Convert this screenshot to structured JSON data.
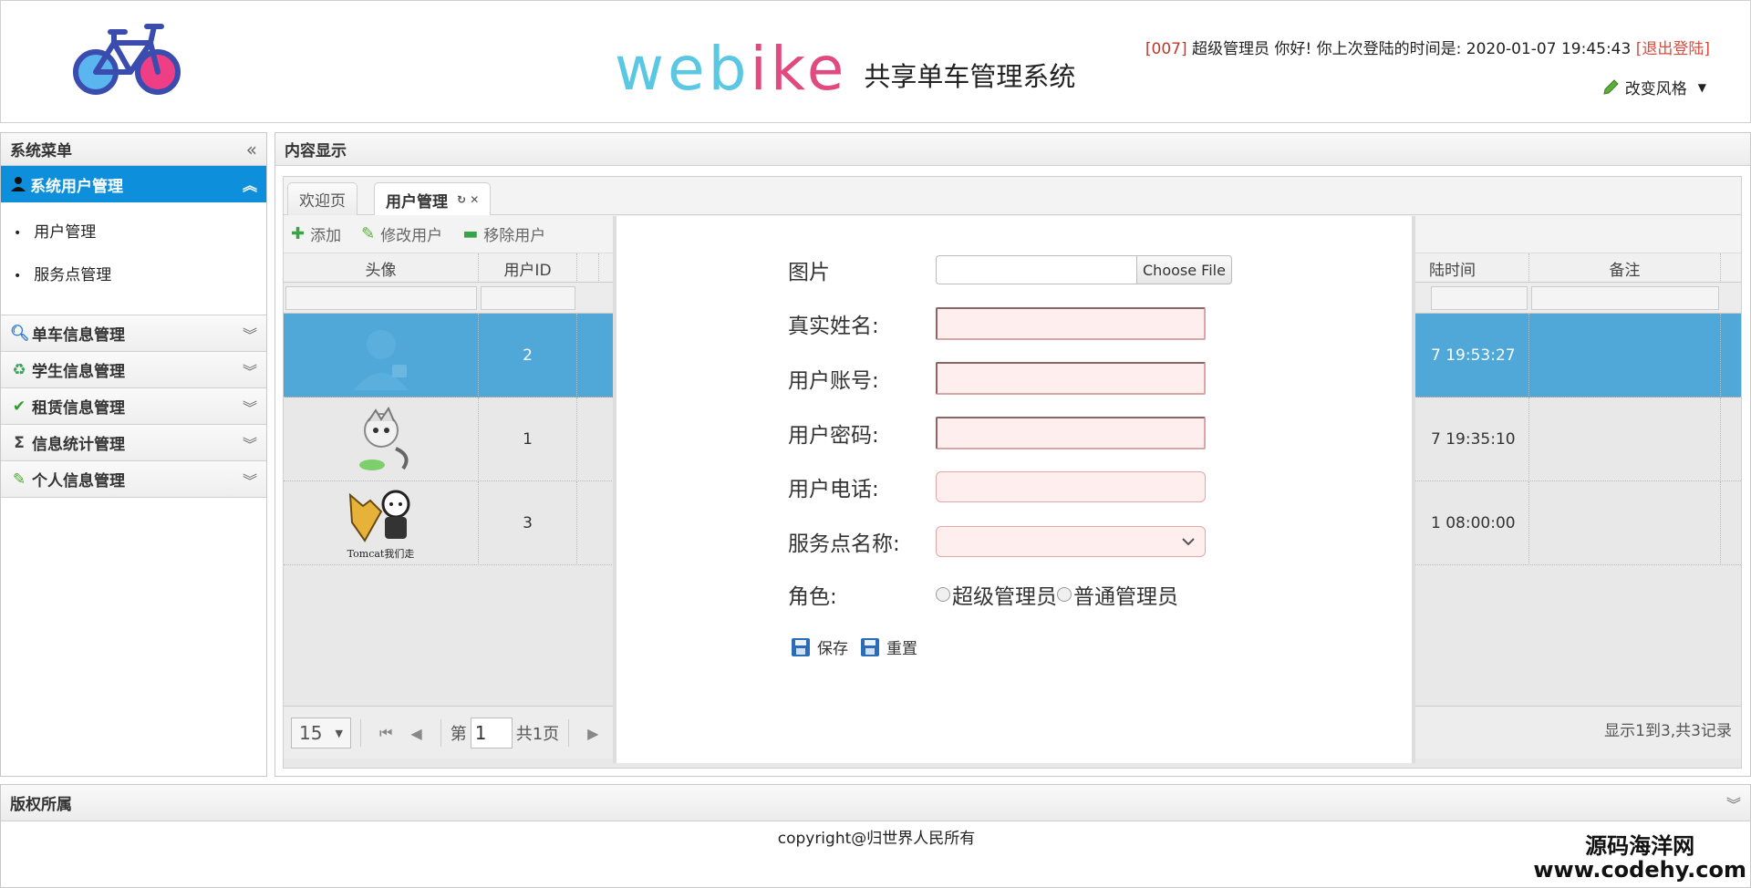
{
  "header": {
    "brand_web": "web",
    "brand_i": "i",
    "brand_ke": "ke",
    "subtitle": "共享单车管理系统",
    "user_id_tag": "[007]",
    "greeting": " 超级管理员 你好! 你上次登陆的时间是: ",
    "last_login": "2020-01-07 19:45:43",
    "logout": "[退出登陆]",
    "change_style": "改变风格"
  },
  "sidebar": {
    "title": "系统菜单",
    "active_group": "系统用户管理",
    "sub_items": [
      "用户管理",
      "服务点管理"
    ],
    "groups": [
      {
        "label": "单车信息管理",
        "icon": "search-icon"
      },
      {
        "label": "学生信息管理",
        "icon": "refresh-icon"
      },
      {
        "label": "租赁信息管理",
        "icon": "check-icon"
      },
      {
        "label": "信息统计管理",
        "icon": "sigma-icon"
      },
      {
        "label": "个人信息管理",
        "icon": "pencil-icon"
      }
    ]
  },
  "content": {
    "title": "内容显示",
    "tabs": [
      {
        "label": "欢迎页"
      },
      {
        "label": "用户管理"
      }
    ],
    "toolbar": {
      "add": "添加",
      "edit": "修改用户",
      "remove": "移除用户"
    },
    "grid": {
      "columns": [
        "头像",
        "用户ID",
        "陆时间",
        "备注"
      ],
      "rows": [
        {
          "id": "2",
          "time": "7 19:53:27",
          "note": ""
        },
        {
          "id": "1",
          "time": "7 19:35:10",
          "note": ""
        },
        {
          "id": "3",
          "time": "1 08:00:00",
          "note": ""
        }
      ],
      "tomcat_caption": "Tomcat我们走"
    },
    "pager": {
      "page_size": "15",
      "page_prefix": "第",
      "page_value": "1",
      "page_total": "共1页",
      "summary": "显示1到3,共3记录"
    }
  },
  "dialog": {
    "photo_label": "图片",
    "choose_file": "Choose File",
    "realname_label": "真实姓名:",
    "account_label": "用户账号:",
    "password_label": "用户密码:",
    "phone_label": "用户电话:",
    "service_label": "服务点名称:",
    "role_label": "角色:",
    "role_options": [
      "超级管理员",
      "普通管理员"
    ],
    "save": "保存",
    "reset": "重置"
  },
  "footer": {
    "title": "版权所属",
    "copyright": "copyright@归世界人民所有",
    "watermark_cn": "源码海洋网",
    "watermark_url": "www.codehy.com"
  },
  "colors": {
    "accent": "#0d8fdb",
    "selected_row": "#4fa8d8",
    "brand_blue": "#5bc8e3",
    "brand_pink": "#e14a7e",
    "field_bg": "#ffeeee"
  }
}
